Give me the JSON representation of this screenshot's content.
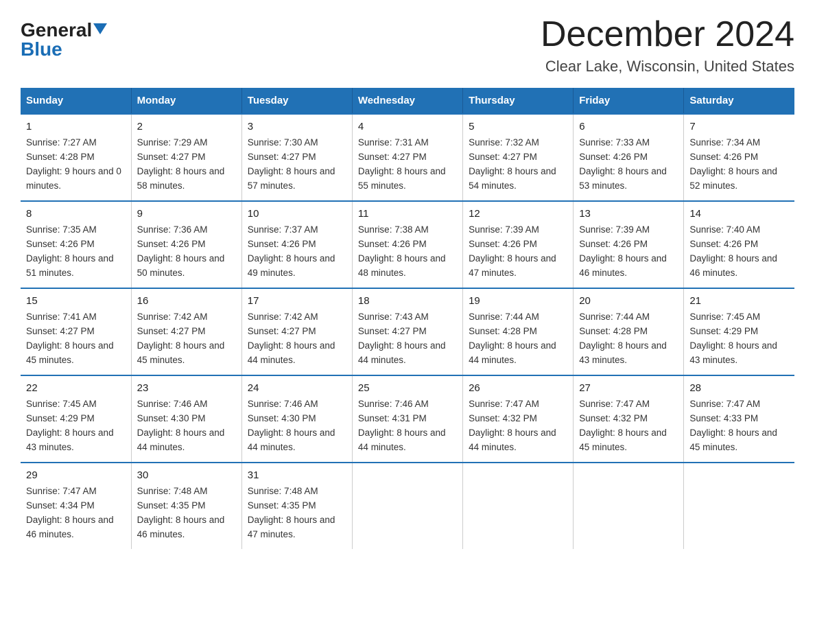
{
  "logo": {
    "general": "General",
    "blue": "Blue"
  },
  "title": "December 2024",
  "subtitle": "Clear Lake, Wisconsin, United States",
  "days_header": [
    "Sunday",
    "Monday",
    "Tuesday",
    "Wednesday",
    "Thursday",
    "Friday",
    "Saturday"
  ],
  "weeks": [
    [
      {
        "num": "1",
        "sunrise": "7:27 AM",
        "sunset": "4:28 PM",
        "daylight": "9 hours and 0 minutes."
      },
      {
        "num": "2",
        "sunrise": "7:29 AM",
        "sunset": "4:27 PM",
        "daylight": "8 hours and 58 minutes."
      },
      {
        "num": "3",
        "sunrise": "7:30 AM",
        "sunset": "4:27 PM",
        "daylight": "8 hours and 57 minutes."
      },
      {
        "num": "4",
        "sunrise": "7:31 AM",
        "sunset": "4:27 PM",
        "daylight": "8 hours and 55 minutes."
      },
      {
        "num": "5",
        "sunrise": "7:32 AM",
        "sunset": "4:27 PM",
        "daylight": "8 hours and 54 minutes."
      },
      {
        "num": "6",
        "sunrise": "7:33 AM",
        "sunset": "4:26 PM",
        "daylight": "8 hours and 53 minutes."
      },
      {
        "num": "7",
        "sunrise": "7:34 AM",
        "sunset": "4:26 PM",
        "daylight": "8 hours and 52 minutes."
      }
    ],
    [
      {
        "num": "8",
        "sunrise": "7:35 AM",
        "sunset": "4:26 PM",
        "daylight": "8 hours and 51 minutes."
      },
      {
        "num": "9",
        "sunrise": "7:36 AM",
        "sunset": "4:26 PM",
        "daylight": "8 hours and 50 minutes."
      },
      {
        "num": "10",
        "sunrise": "7:37 AM",
        "sunset": "4:26 PM",
        "daylight": "8 hours and 49 minutes."
      },
      {
        "num": "11",
        "sunrise": "7:38 AM",
        "sunset": "4:26 PM",
        "daylight": "8 hours and 48 minutes."
      },
      {
        "num": "12",
        "sunrise": "7:39 AM",
        "sunset": "4:26 PM",
        "daylight": "8 hours and 47 minutes."
      },
      {
        "num": "13",
        "sunrise": "7:39 AM",
        "sunset": "4:26 PM",
        "daylight": "8 hours and 46 minutes."
      },
      {
        "num": "14",
        "sunrise": "7:40 AM",
        "sunset": "4:26 PM",
        "daylight": "8 hours and 46 minutes."
      }
    ],
    [
      {
        "num": "15",
        "sunrise": "7:41 AM",
        "sunset": "4:27 PM",
        "daylight": "8 hours and 45 minutes."
      },
      {
        "num": "16",
        "sunrise": "7:42 AM",
        "sunset": "4:27 PM",
        "daylight": "8 hours and 45 minutes."
      },
      {
        "num": "17",
        "sunrise": "7:42 AM",
        "sunset": "4:27 PM",
        "daylight": "8 hours and 44 minutes."
      },
      {
        "num": "18",
        "sunrise": "7:43 AM",
        "sunset": "4:27 PM",
        "daylight": "8 hours and 44 minutes."
      },
      {
        "num": "19",
        "sunrise": "7:44 AM",
        "sunset": "4:28 PM",
        "daylight": "8 hours and 44 minutes."
      },
      {
        "num": "20",
        "sunrise": "7:44 AM",
        "sunset": "4:28 PM",
        "daylight": "8 hours and 43 minutes."
      },
      {
        "num": "21",
        "sunrise": "7:45 AM",
        "sunset": "4:29 PM",
        "daylight": "8 hours and 43 minutes."
      }
    ],
    [
      {
        "num": "22",
        "sunrise": "7:45 AM",
        "sunset": "4:29 PM",
        "daylight": "8 hours and 43 minutes."
      },
      {
        "num": "23",
        "sunrise": "7:46 AM",
        "sunset": "4:30 PM",
        "daylight": "8 hours and 44 minutes."
      },
      {
        "num": "24",
        "sunrise": "7:46 AM",
        "sunset": "4:30 PM",
        "daylight": "8 hours and 44 minutes."
      },
      {
        "num": "25",
        "sunrise": "7:46 AM",
        "sunset": "4:31 PM",
        "daylight": "8 hours and 44 minutes."
      },
      {
        "num": "26",
        "sunrise": "7:47 AM",
        "sunset": "4:32 PM",
        "daylight": "8 hours and 44 minutes."
      },
      {
        "num": "27",
        "sunrise": "7:47 AM",
        "sunset": "4:32 PM",
        "daylight": "8 hours and 45 minutes."
      },
      {
        "num": "28",
        "sunrise": "7:47 AM",
        "sunset": "4:33 PM",
        "daylight": "8 hours and 45 minutes."
      }
    ],
    [
      {
        "num": "29",
        "sunrise": "7:47 AM",
        "sunset": "4:34 PM",
        "daylight": "8 hours and 46 minutes."
      },
      {
        "num": "30",
        "sunrise": "7:48 AM",
        "sunset": "4:35 PM",
        "daylight": "8 hours and 46 minutes."
      },
      {
        "num": "31",
        "sunrise": "7:48 AM",
        "sunset": "4:35 PM",
        "daylight": "8 hours and 47 minutes."
      },
      null,
      null,
      null,
      null
    ]
  ],
  "labels": {
    "sunrise_prefix": "Sunrise: ",
    "sunset_prefix": "Sunset: ",
    "daylight_prefix": "Daylight: "
  }
}
